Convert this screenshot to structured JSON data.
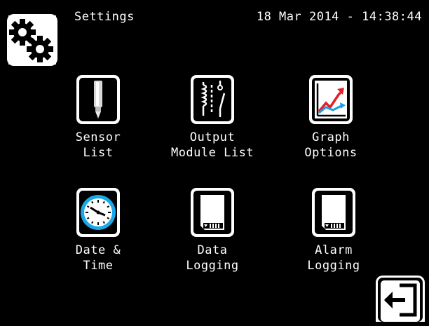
{
  "header": {
    "title": "Settings",
    "datetime": "18 Mar  2014 - 14:38:44",
    "settings_icon": "gears-icon"
  },
  "menu": {
    "items": [
      {
        "line1": "Sensor",
        "line2": "List",
        "icon": "sensor-probe-icon"
      },
      {
        "line1": "Output",
        "line2": "Module List",
        "icon": "relay-icon"
      },
      {
        "line1": "Graph",
        "line2": "Options",
        "icon": "graph-icon"
      },
      {
        "line1": "Date &",
        "line2": "Time",
        "icon": "clock-icon"
      },
      {
        "line1": "Data",
        "line2": "Logging",
        "icon": "sd-card-icon"
      },
      {
        "line1": "Alarm",
        "line2": "Logging",
        "icon": "sd-card-icon"
      }
    ]
  },
  "footer": {
    "exit_icon": "exit-icon"
  },
  "colors": {
    "background": "#000000",
    "foreground": "#ffffff",
    "graph_red": "#e0202a",
    "graph_blue": "#1aa0e0",
    "clock_blue": "#1aa8e8"
  }
}
